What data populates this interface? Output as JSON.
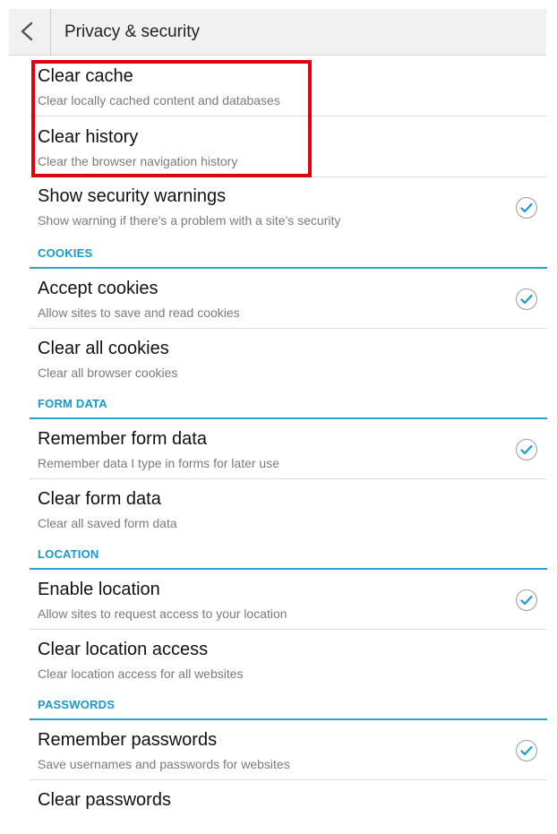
{
  "header": {
    "title": "Privacy & security"
  },
  "rows_top": [
    {
      "title": "Clear cache",
      "subtitle": "Clear locally cached content and databases",
      "checked": false
    },
    {
      "title": "Clear history",
      "subtitle": "Clear the browser navigation history",
      "checked": false
    },
    {
      "title": "Show security warnings",
      "subtitle": "Show warning if there's a problem with a site's security",
      "checked": true
    }
  ],
  "sections": [
    {
      "label": "COOKIES",
      "rows": [
        {
          "title": "Accept cookies",
          "subtitle": "Allow sites to save and read cookies",
          "checked": true
        },
        {
          "title": "Clear all cookies",
          "subtitle": "Clear all browser cookies",
          "checked": false
        }
      ]
    },
    {
      "label": "FORM DATA",
      "rows": [
        {
          "title": "Remember form data",
          "subtitle": "Remember data I type in forms for later use",
          "checked": true
        },
        {
          "title": "Clear form data",
          "subtitle": "Clear all saved form data",
          "checked": false
        }
      ]
    },
    {
      "label": "LOCATION",
      "rows": [
        {
          "title": "Enable location",
          "subtitle": "Allow sites to request access to your location",
          "checked": true
        },
        {
          "title": "Clear location access",
          "subtitle": "Clear location access for all websites",
          "checked": false
        }
      ]
    },
    {
      "label": "PASSWORDS",
      "rows": [
        {
          "title": "Remember passwords",
          "subtitle": "Save usernames and passwords for websites",
          "checked": true
        },
        {
          "title": "Clear passwords",
          "subtitle": "",
          "checked": false
        }
      ]
    }
  ],
  "icons": {
    "back": "chevron-left-icon",
    "checkbox": "checkmark-icon"
  },
  "colors": {
    "accent": "#1a98cc",
    "section_rule": "#2aa3cf",
    "highlight": "#e0000f",
    "header_bg": "#f1f1f1"
  }
}
